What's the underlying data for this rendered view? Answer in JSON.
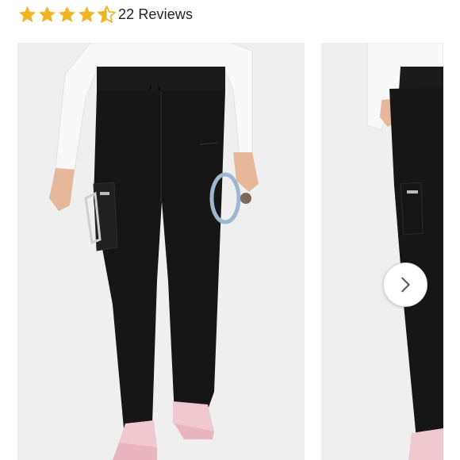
{
  "rating": {
    "value": 4.5,
    "max": 5,
    "reviews_label": "22 Reviews",
    "star_color": "#f1b423"
  },
  "carousel": {
    "slides": [
      {
        "name": "product-image-front",
        "icon": "scrub-pants-front-image"
      },
      {
        "name": "product-image-side",
        "icon": "scrub-pants-side-image"
      }
    ],
    "next_icon": "chevron-right-icon"
  },
  "colors": {
    "pants": "#151515",
    "shirt": "#f7f7f7",
    "background": "#efefef",
    "shoe": "#f0c8cf"
  }
}
